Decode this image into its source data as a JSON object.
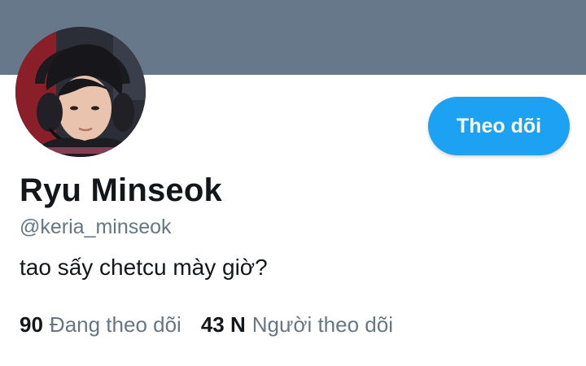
{
  "profile": {
    "display_name": "Ryu Minseok",
    "handle": "@keria_minseok",
    "bio": "tao sấy chetcu mày giờ?",
    "follow_button_label": "Theo dõi",
    "stats": {
      "following_count": "90",
      "following_label": "Đang theo dõi",
      "followers_count": "43 N",
      "followers_label": "Người theo dõi"
    }
  },
  "colors": {
    "banner": "#66788a",
    "accent": "#1da1f2",
    "primary_text": "#14171a",
    "secondary_text": "#657786"
  }
}
